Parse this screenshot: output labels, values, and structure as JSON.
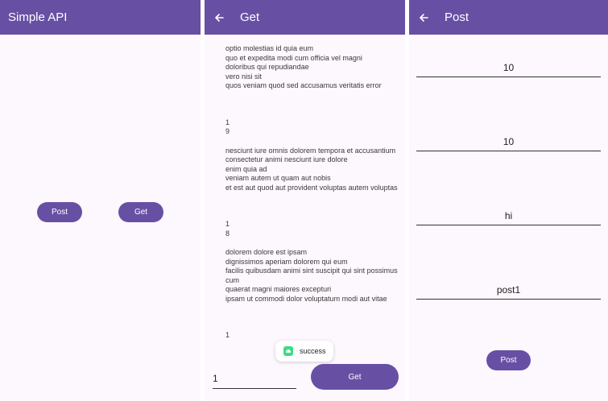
{
  "home": {
    "title": "Simple API",
    "post_label": "Post",
    "get_label": "Get"
  },
  "get_screen": {
    "title": "Get",
    "lines_a": [
      "optio molestias id quia eum",
      "quo et expedita modi cum officia vel magni",
      "doloribus qui repudiandae",
      "vero nisi sit",
      "quos veniam quod sed accusamus veritatis error"
    ],
    "nums_a": [
      "1",
      "9"
    ],
    "lines_b": [
      "nesciunt iure omnis dolorem tempora et accusantium",
      "consectetur animi nesciunt iure dolore",
      "enim quia ad",
      "veniam autem ut quam aut nobis",
      "et est aut quod aut provident voluptas autem voluptas"
    ],
    "nums_b": [
      "1",
      "8"
    ],
    "lines_c": [
      "dolorem dolore est ipsam",
      "dignissimos aperiam dolorem qui eum",
      "facilis quibusdam animi sint suscipit qui sint possimus",
      "cum",
      "quaerat magni maiores excepturi",
      "ipsam ut commodi dolor voluptatum modi aut vitae"
    ],
    "nums_c": [
      "1"
    ],
    "toast_text": "success",
    "input_value": "1",
    "get_button_label": "Get"
  },
  "post_screen": {
    "title": "Post",
    "fields": [
      "10",
      "10",
      "hi",
      "post1"
    ],
    "post_button_label": "Post"
  },
  "colors": {
    "primary": "#6750a4",
    "background": "#fdf7fe"
  }
}
